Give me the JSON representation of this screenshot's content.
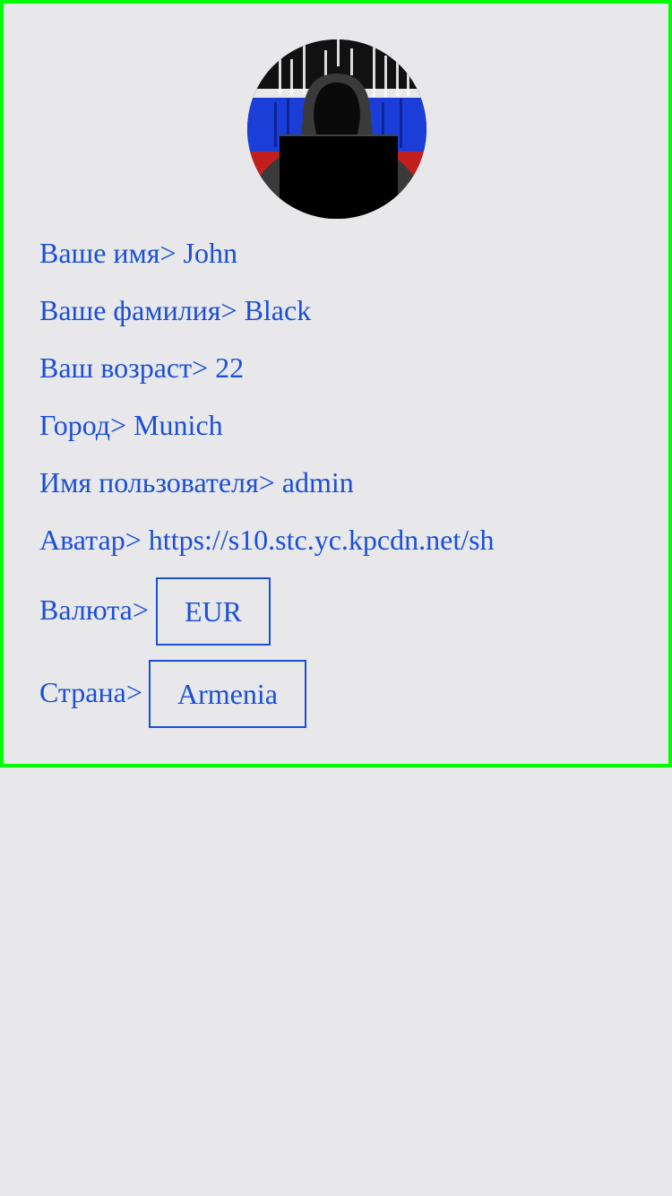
{
  "profile": {
    "avatar_alt": "hooded figure in front of laptop with flag-colored code background",
    "fields": [
      {
        "label": "Ваше имя>",
        "value": "John"
      },
      {
        "label": "Ваше фамилия>",
        "value": "Black"
      },
      {
        "label": "Ваш возраст>",
        "value": "22"
      },
      {
        "label": "Город>",
        "value": "Munich"
      },
      {
        "label": "Имя пользователя>",
        "value": "admin"
      },
      {
        "label": "Аватар>",
        "value": "https://s10.stc.yc.kpcdn.net/sh"
      }
    ],
    "currency": {
      "label": "Валюта>",
      "selected": "EUR"
    },
    "country": {
      "label": "Страна>",
      "selected": "Armenia"
    }
  },
  "colors": {
    "text": "#1a4fd6",
    "border": "#00ff00",
    "background": "#e8e8ea"
  }
}
